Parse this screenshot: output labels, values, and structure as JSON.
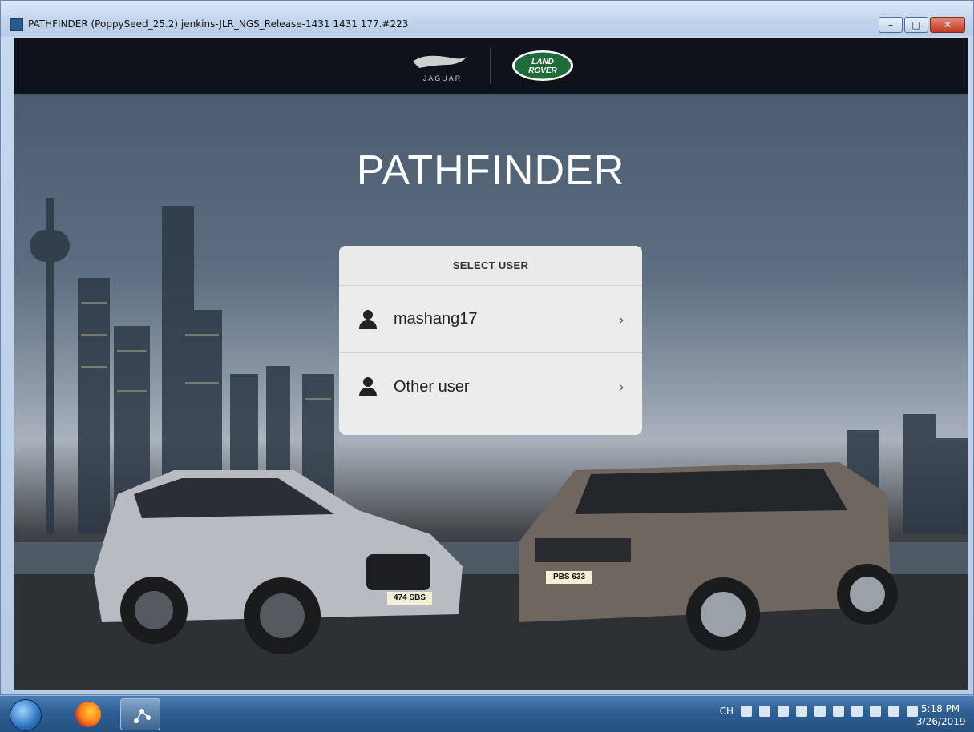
{
  "window": {
    "title": "PATHFINDER (PoppySeed_25.2) jenkins-JLR_NGS_Release-1431 1431 177.#223",
    "minimize_label": "–",
    "maximize_label": "□",
    "close_label": "✕"
  },
  "brand": {
    "jaguar_label": "JAGUAR",
    "land_rover_label": "LAND ROVER"
  },
  "app": {
    "title": "PATHFINDER"
  },
  "select_user": {
    "header": "SELECT USER",
    "users": [
      {
        "name": "mashang17"
      },
      {
        "name": "Other user"
      }
    ]
  },
  "taskbar": {
    "language": "CH",
    "time": "5:18 PM",
    "date": "3/26/2019"
  },
  "cars": {
    "jaguar_plate": "474 SBS",
    "land_rover_plate": "PBS 633"
  },
  "colors": {
    "brand_bar": "#0e121b",
    "land_rover_green": "#1f6b3a",
    "card_bg": "#eeeeee",
    "taskbar": "#2f5f93"
  }
}
